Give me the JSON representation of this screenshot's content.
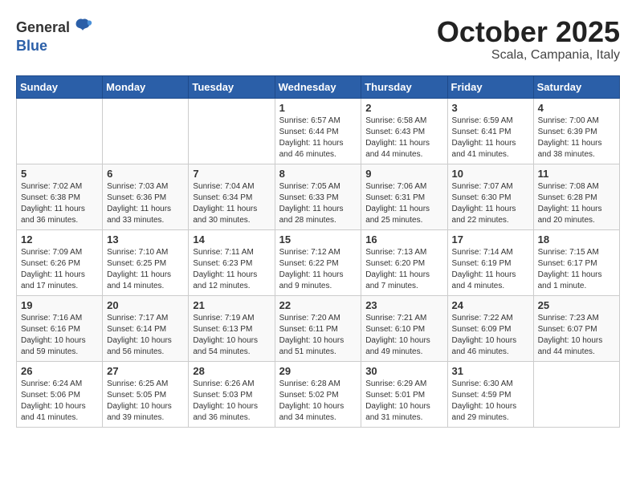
{
  "header": {
    "logo_general": "General",
    "logo_blue": "Blue",
    "month": "October 2025",
    "location": "Scala, Campania, Italy"
  },
  "weekdays": [
    "Sunday",
    "Monday",
    "Tuesday",
    "Wednesday",
    "Thursday",
    "Friday",
    "Saturday"
  ],
  "weeks": [
    [
      {
        "day": "",
        "info": ""
      },
      {
        "day": "",
        "info": ""
      },
      {
        "day": "",
        "info": ""
      },
      {
        "day": "1",
        "info": "Sunrise: 6:57 AM\nSunset: 6:44 PM\nDaylight: 11 hours\nand 46 minutes."
      },
      {
        "day": "2",
        "info": "Sunrise: 6:58 AM\nSunset: 6:43 PM\nDaylight: 11 hours\nand 44 minutes."
      },
      {
        "day": "3",
        "info": "Sunrise: 6:59 AM\nSunset: 6:41 PM\nDaylight: 11 hours\nand 41 minutes."
      },
      {
        "day": "4",
        "info": "Sunrise: 7:00 AM\nSunset: 6:39 PM\nDaylight: 11 hours\nand 38 minutes."
      }
    ],
    [
      {
        "day": "5",
        "info": "Sunrise: 7:02 AM\nSunset: 6:38 PM\nDaylight: 11 hours\nand 36 minutes."
      },
      {
        "day": "6",
        "info": "Sunrise: 7:03 AM\nSunset: 6:36 PM\nDaylight: 11 hours\nand 33 minutes."
      },
      {
        "day": "7",
        "info": "Sunrise: 7:04 AM\nSunset: 6:34 PM\nDaylight: 11 hours\nand 30 minutes."
      },
      {
        "day": "8",
        "info": "Sunrise: 7:05 AM\nSunset: 6:33 PM\nDaylight: 11 hours\nand 28 minutes."
      },
      {
        "day": "9",
        "info": "Sunrise: 7:06 AM\nSunset: 6:31 PM\nDaylight: 11 hours\nand 25 minutes."
      },
      {
        "day": "10",
        "info": "Sunrise: 7:07 AM\nSunset: 6:30 PM\nDaylight: 11 hours\nand 22 minutes."
      },
      {
        "day": "11",
        "info": "Sunrise: 7:08 AM\nSunset: 6:28 PM\nDaylight: 11 hours\nand 20 minutes."
      }
    ],
    [
      {
        "day": "12",
        "info": "Sunrise: 7:09 AM\nSunset: 6:26 PM\nDaylight: 11 hours\nand 17 minutes."
      },
      {
        "day": "13",
        "info": "Sunrise: 7:10 AM\nSunset: 6:25 PM\nDaylight: 11 hours\nand 14 minutes."
      },
      {
        "day": "14",
        "info": "Sunrise: 7:11 AM\nSunset: 6:23 PM\nDaylight: 11 hours\nand 12 minutes."
      },
      {
        "day": "15",
        "info": "Sunrise: 7:12 AM\nSunset: 6:22 PM\nDaylight: 11 hours\nand 9 minutes."
      },
      {
        "day": "16",
        "info": "Sunrise: 7:13 AM\nSunset: 6:20 PM\nDaylight: 11 hours\nand 7 minutes."
      },
      {
        "day": "17",
        "info": "Sunrise: 7:14 AM\nSunset: 6:19 PM\nDaylight: 11 hours\nand 4 minutes."
      },
      {
        "day": "18",
        "info": "Sunrise: 7:15 AM\nSunset: 6:17 PM\nDaylight: 11 hours\nand 1 minute."
      }
    ],
    [
      {
        "day": "19",
        "info": "Sunrise: 7:16 AM\nSunset: 6:16 PM\nDaylight: 10 hours\nand 59 minutes."
      },
      {
        "day": "20",
        "info": "Sunrise: 7:17 AM\nSunset: 6:14 PM\nDaylight: 10 hours\nand 56 minutes."
      },
      {
        "day": "21",
        "info": "Sunrise: 7:19 AM\nSunset: 6:13 PM\nDaylight: 10 hours\nand 54 minutes."
      },
      {
        "day": "22",
        "info": "Sunrise: 7:20 AM\nSunset: 6:11 PM\nDaylight: 10 hours\nand 51 minutes."
      },
      {
        "day": "23",
        "info": "Sunrise: 7:21 AM\nSunset: 6:10 PM\nDaylight: 10 hours\nand 49 minutes."
      },
      {
        "day": "24",
        "info": "Sunrise: 7:22 AM\nSunset: 6:09 PM\nDaylight: 10 hours\nand 46 minutes."
      },
      {
        "day": "25",
        "info": "Sunrise: 7:23 AM\nSunset: 6:07 PM\nDaylight: 10 hours\nand 44 minutes."
      }
    ],
    [
      {
        "day": "26",
        "info": "Sunrise: 6:24 AM\nSunset: 5:06 PM\nDaylight: 10 hours\nand 41 minutes."
      },
      {
        "day": "27",
        "info": "Sunrise: 6:25 AM\nSunset: 5:05 PM\nDaylight: 10 hours\nand 39 minutes."
      },
      {
        "day": "28",
        "info": "Sunrise: 6:26 AM\nSunset: 5:03 PM\nDaylight: 10 hours\nand 36 minutes."
      },
      {
        "day": "29",
        "info": "Sunrise: 6:28 AM\nSunset: 5:02 PM\nDaylight: 10 hours\nand 34 minutes."
      },
      {
        "day": "30",
        "info": "Sunrise: 6:29 AM\nSunset: 5:01 PM\nDaylight: 10 hours\nand 31 minutes."
      },
      {
        "day": "31",
        "info": "Sunrise: 6:30 AM\nSunset: 4:59 PM\nDaylight: 10 hours\nand 29 minutes."
      },
      {
        "day": "",
        "info": ""
      }
    ]
  ]
}
